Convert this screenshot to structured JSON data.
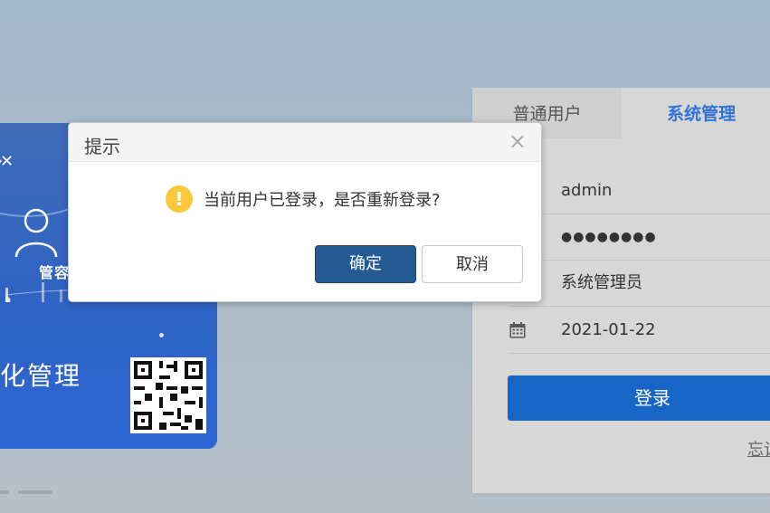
{
  "promo": {
    "tag_label": "管容",
    "title": "化管理"
  },
  "login": {
    "tabs": [
      {
        "label": "普通用户"
      },
      {
        "label": "系统管理"
      }
    ],
    "username_value": "admin",
    "password_mask": "●●●●●●●●",
    "role_value": "系统管理员",
    "date_value": "2021-01-22",
    "login_button": "登录",
    "forgot_link": "忘记"
  },
  "dialog": {
    "title": "提示",
    "close_glyph": "×",
    "message": "当前用户已登录，是否重新登录?",
    "ok_label": "确定",
    "cancel_label": "取消"
  },
  "colors": {
    "accent": "#2f73d6",
    "login_button": "#1765c7",
    "ok_button": "#245b94",
    "warning": "#f9c93b"
  }
}
